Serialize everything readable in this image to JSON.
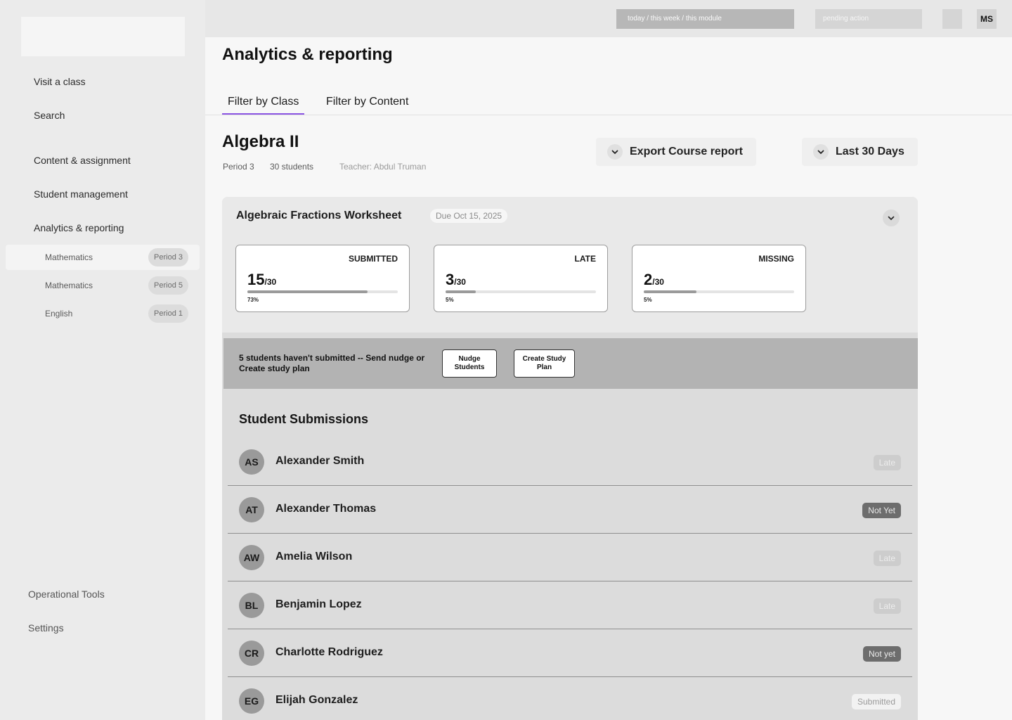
{
  "sidebar": {
    "nav": [
      "Visit a class",
      "Search",
      "Content & assignment",
      "Student management",
      "Analytics & reporting"
    ],
    "classes": [
      {
        "label": "Mathematics",
        "period": "Period 3"
      },
      {
        "label": "Mathematics",
        "period": "Period 5"
      },
      {
        "label": "English",
        "period": "Period 1"
      }
    ],
    "bottom": [
      "Operational Tools",
      "Settings"
    ]
  },
  "topbar": {
    "scope_label": "today / this week / this module",
    "pending_label": "pending action",
    "user_initials": "MS"
  },
  "page": {
    "title": "Analytics & reporting",
    "tabs": [
      "Filter by Class",
      "Filter by Content"
    ]
  },
  "class_info": {
    "title": "Algebra II",
    "period": "Period 3",
    "students": "30 students",
    "teacher": "Teacher: Abdul Truman",
    "export_label": "Export Course report",
    "range_label": "Last 30 Days"
  },
  "assignment": {
    "title": "Algebraic Fractions Worksheet",
    "due": "Due Oct 15, 2025",
    "stats": [
      {
        "label": "SUBMITTED",
        "value": "15",
        "total": "/30",
        "pct": "73%",
        "fill": 0.8
      },
      {
        "label": "LATE",
        "value": "3",
        "total": "/30",
        "pct": "5%",
        "fill": 0.2
      },
      {
        "label": "MISSING",
        "value": "2",
        "total": "/30",
        "pct": "5%",
        "fill": 0.35
      }
    ],
    "alert": {
      "text": "5 students haven't submitted -- Send nudge or Create study plan",
      "nudge_label": "Nudge Students",
      "plan_label": "Create Study Plan"
    },
    "submissions_title": "Student Submissions",
    "students": [
      {
        "initials": "AS",
        "name": "Alexander Smith",
        "status": "Late",
        "kind": "late"
      },
      {
        "initials": "AT",
        "name": "Alexander Thomas",
        "status": "Not Yet",
        "kind": "notyet"
      },
      {
        "initials": "AW",
        "name": "Amelia Wilson",
        "status": "Late",
        "kind": "late"
      },
      {
        "initials": "BL",
        "name": "Benjamin Lopez",
        "status": "Late",
        "kind": "late"
      },
      {
        "initials": "CR",
        "name": "Charlotte Rodriguez",
        "status": "Not yet",
        "kind": "notyet"
      },
      {
        "initials": "EG",
        "name": "Elijah Gonzalez",
        "status": "Submitted",
        "kind": "submitted"
      }
    ]
  }
}
